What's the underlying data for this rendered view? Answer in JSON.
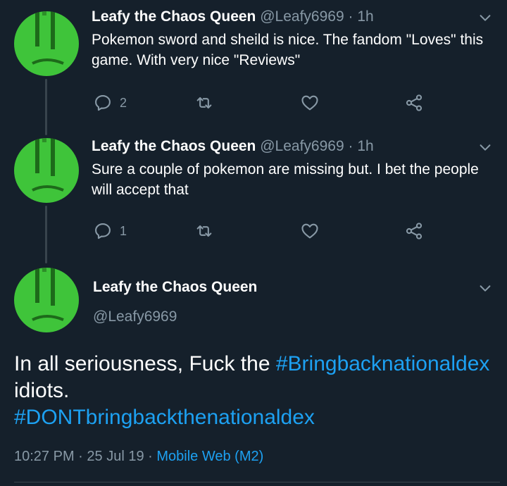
{
  "thread": [
    {
      "name": "Leafy the Chaos Queen",
      "handle": "@Leafy6969",
      "separator": "·",
      "time": "1h",
      "text": "Pokemon sword and sheild is nice. The fandom \"Loves\" this game. With very nice \"Reviews\"",
      "reply_count": "2"
    },
    {
      "name": "Leafy the Chaos Queen",
      "handle": "@Leafy6969",
      "separator": "·",
      "time": "1h",
      "text": "Sure a couple of pokemon are missing but. I bet the people will accept that",
      "reply_count": "1"
    }
  ],
  "main_tweet": {
    "name": "Leafy the Chaos Queen",
    "handle": "@Leafy6969",
    "text_lead": "In all seriousness, Fuck the ",
    "hashtag_1": "#Bringbacknationaldex",
    "text_mid": " idiots.",
    "hashtag_2": "#DONTbringbackthenationaldex",
    "time": "10:27 PM",
    "separator": "·",
    "date": "25 Jul 19",
    "source": "Mobile Web (M2)"
  },
  "colors": {
    "background": "#15202b",
    "secondary_text": "#8899a6",
    "accent": "#1da1f2",
    "avatar_green": "#3fc43a"
  },
  "icons": [
    "reply-icon",
    "retweet-icon",
    "like-icon",
    "share-icon",
    "chevron-down-icon"
  ]
}
